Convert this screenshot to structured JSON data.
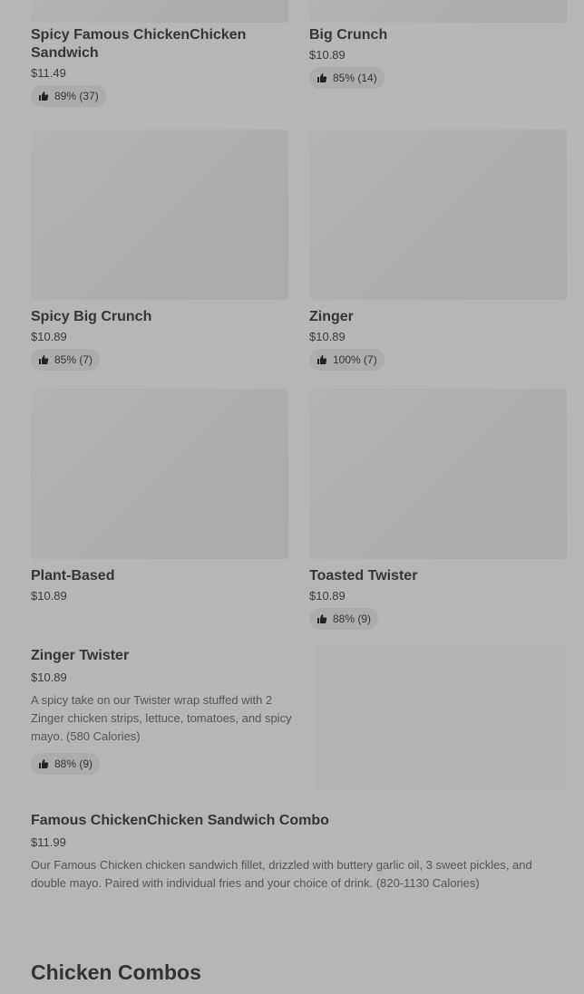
{
  "items": [
    {
      "name": "Spicy Famous ChickenChicken Sandwich",
      "price": "$11.49",
      "rating": "89% (37)"
    },
    {
      "name": "Big Crunch",
      "price": "$10.89",
      "rating": "85% (14)"
    },
    {
      "name": "Spicy Big Crunch",
      "price": "$10.89",
      "rating": "85% (7)"
    },
    {
      "name": "Zinger",
      "price": "$10.89",
      "rating": "100% (7)"
    },
    {
      "name": "Plant-Based",
      "price": "$10.89"
    },
    {
      "name": "Toasted Twister",
      "price": "$10.89",
      "rating": "88% (9)"
    }
  ],
  "zinger_twister": {
    "name": "Zinger Twister",
    "price": "$10.89",
    "description": "A spicy take on our Twister wrap stuffed with 2 Zinger chicken strips, lettuce, tomatoes, and spicy mayo. (580 Calories)",
    "rating": "88% (9)"
  },
  "combo": {
    "name": "Famous ChickenChicken Sandwich Combo",
    "price": "$11.99",
    "description": "Our Famous Chicken chicken sandwich fillet, drizzled with buttery garlic oil, 3 sweet pickles, and double mayo. Paired with individual fries and your choice of drink. (820-1130 Calories)"
  },
  "section_heading": "Chicken Combos",
  "icons": {
    "rating": "thumbs-up-icon"
  },
  "colors": {
    "overlay_background": "#b6b6b6"
  }
}
